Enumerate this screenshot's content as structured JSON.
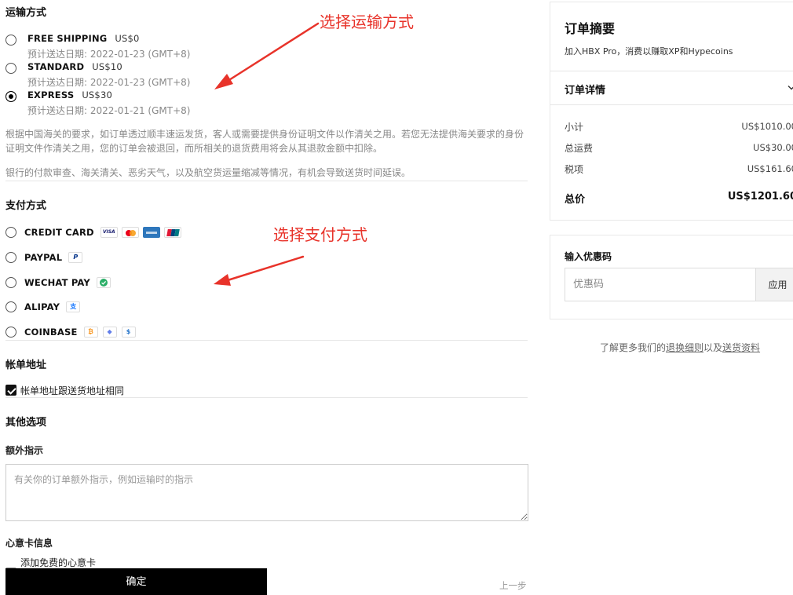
{
  "shipping": {
    "title": "运输方式",
    "options": [
      {
        "label": "FREE SHIPPING",
        "price": "US$0",
        "date": "预计送达日期: 2022-01-23 (GMT+8)",
        "selected": false
      },
      {
        "label": "STANDARD",
        "price": "US$10",
        "date": "预计送达日期: 2022-01-23 (GMT+8)",
        "selected": false
      },
      {
        "label": "EXPRESS",
        "price": "US$30",
        "date": "预计送达日期: 2022-01-21 (GMT+8)",
        "selected": true
      }
    ],
    "notice1": "根据中国海关的要求，如订单透过顺丰速运发货，客人或需要提供身份证明文件以作清关之用。若您无法提供海关要求的身份证明文件作清关之用，您的订单会被退回，而所相关的退货费用将会从其退款金额中扣除。",
    "notice2": "银行的付款审查、海关清关、恶劣天气，以及航空货运量缩减等情况，有机会导致送货时间延误。"
  },
  "annotations": {
    "shipping": "选择运输方式",
    "payment": "选择支付方式"
  },
  "payment": {
    "title": "支付方式",
    "options": [
      {
        "label": "CREDIT CARD",
        "icons": [
          "visa-icon",
          "mastercard-icon",
          "amex-icon",
          "unionpay-icon"
        ]
      },
      {
        "label": "PAYPAL",
        "icons": [
          "paypal-icon"
        ]
      },
      {
        "label": "WECHAT PAY",
        "icons": [
          "wechat-pay-icon"
        ]
      },
      {
        "label": "ALIPAY",
        "icons": [
          "alipay-icon"
        ]
      },
      {
        "label": "COINBASE",
        "icons": [
          "bitcoin-icon",
          "ethereum-icon",
          "usdc-icon"
        ]
      }
    ],
    "visa_text": "VISA",
    "paypal_glyph": "P",
    "alipay_glyph": "支",
    "coin_glyphs": [
      "₿",
      "◆",
      "$"
    ]
  },
  "billing": {
    "title": "帐单地址",
    "same_as_shipping": "帐单地址跟送货地址相同",
    "checked": true
  },
  "other": {
    "title": "其他选项",
    "instructions_label": "额外指示",
    "instructions_placeholder": "有关你的订单额外指示，例如运输时的指示",
    "gift_label": "心意卡信息",
    "gift_checkbox": "添加免费的心意卡"
  },
  "actions": {
    "confirm": "确定",
    "back": "上一步"
  },
  "summary": {
    "title": "订单摘要",
    "subtitle": "加入HBX Pro，消费以赚取XP和Hypecoins",
    "details_label": "订单详情",
    "rows": [
      {
        "label": "小计",
        "value": "US$1010.00"
      },
      {
        "label": "总运费",
        "value": "US$30.00"
      },
      {
        "label": "税项",
        "value": "US$161.60"
      }
    ],
    "total_label": "总价",
    "total_value": "US$1201.60"
  },
  "coupon": {
    "title": "输入优惠码",
    "placeholder": "优惠码",
    "apply": "应用"
  },
  "policy": {
    "prefix": "了解更多我们的",
    "link1": "退换细则",
    "middle": "以及",
    "link2": "送货资料"
  },
  "colors": {
    "annotation": "#e8332a",
    "primary_button": "#000000",
    "wechat": "#2aae67",
    "alipay": "#1677ff"
  }
}
